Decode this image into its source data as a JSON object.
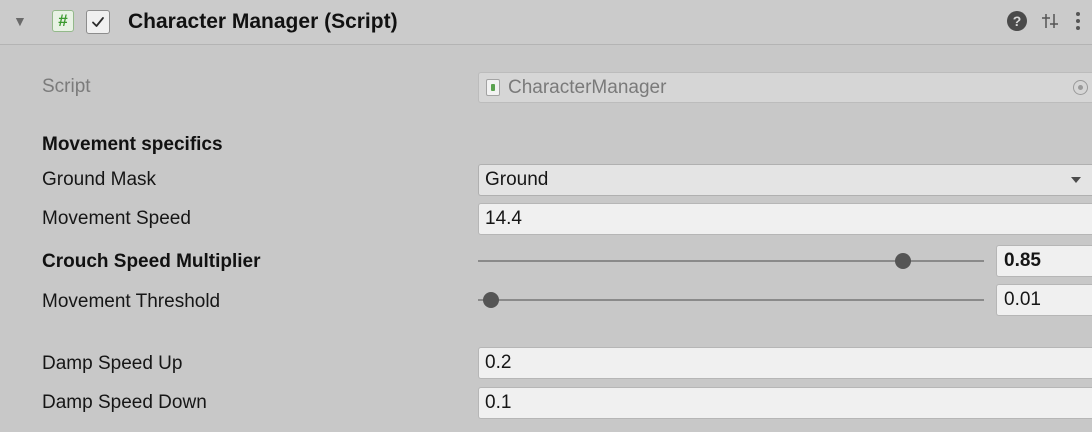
{
  "header": {
    "foldout_icon": "triangle-down-icon",
    "component_icon": "#",
    "enabled": true,
    "title": "Character Manager (Script)",
    "help_icon": "?",
    "preset_icon": "preset-sliders-icon",
    "menu_icon": "kebab-menu-icon"
  },
  "script_row": {
    "label": "Script",
    "value": "CharacterManager",
    "file_icon": "cs-script-file-icon",
    "picker_icon": "object-picker-icon"
  },
  "section": {
    "title": "Movement specifics"
  },
  "ground_mask": {
    "label": "Ground Mask",
    "value": "Ground"
  },
  "movement_speed": {
    "label": "Movement Speed",
    "value": "14.4"
  },
  "crouch_speed_multiplier": {
    "label": "Crouch Speed Multiplier",
    "value": "0.85",
    "slider_fraction": 0.85
  },
  "movement_threshold": {
    "label": "Movement Threshold",
    "value": "0.01",
    "slider_fraction": 0.01
  },
  "damp_speed_up": {
    "label": "Damp Speed Up",
    "value": "0.2"
  },
  "damp_speed_down": {
    "label": "Damp Speed Down",
    "value": "0.1"
  },
  "colors": {
    "background": "#c8c8c8",
    "script_icon_green": "#3b9a2e"
  }
}
